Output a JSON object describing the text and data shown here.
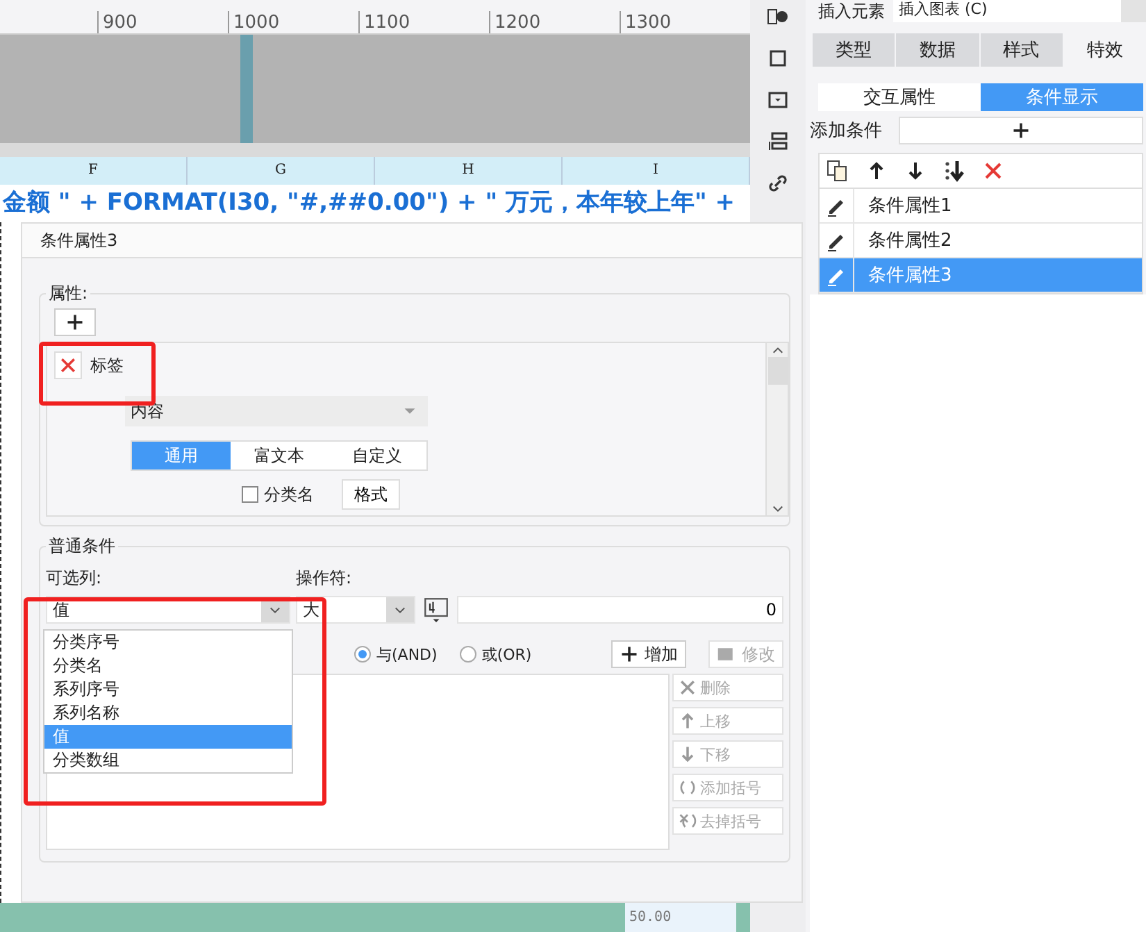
{
  "ruler": {
    "ticks": [
      "900",
      "1000",
      "1100",
      "1200",
      "1300"
    ]
  },
  "sheet": {
    "columns": [
      "F",
      "G",
      "H",
      "I"
    ],
    "formula": "金额 \" + FORMAT(I30, \"#,##0.00\") + \" 万元，本年较上年\" +",
    "footer_value": "50.00"
  },
  "right_panel": {
    "insert_label": "插入元素",
    "insert_value": "插入图表 (C)",
    "tabs": [
      {
        "label": "类型",
        "selected": false
      },
      {
        "label": "数据",
        "selected": false
      },
      {
        "label": "样式",
        "selected": false
      },
      {
        "label": "特效",
        "selected": true
      }
    ],
    "subtabs": [
      {
        "label": "交互属性",
        "selected": false
      },
      {
        "label": "条件显示",
        "selected": true
      }
    ],
    "add_condition_label": "添加条件",
    "conditions": [
      {
        "label": "条件属性1",
        "selected": false
      },
      {
        "label": "条件属性2",
        "selected": false
      },
      {
        "label": "条件属性3",
        "selected": true
      }
    ]
  },
  "dialog": {
    "title": "条件属性3",
    "properties": {
      "legend": "属性:",
      "items": [
        {
          "label": "标签"
        }
      ],
      "content_select": "内容",
      "modes": [
        {
          "label": "通用",
          "selected": true
        },
        {
          "label": "富文本",
          "selected": false
        },
        {
          "label": "自定义",
          "selected": false
        }
      ],
      "category_name": {
        "label": "分类名",
        "checked": false
      },
      "format_button": "格式"
    },
    "conditions": {
      "legend": "普通条件",
      "column_label": "可选列:",
      "operator_label": "操作符:",
      "column_value": "值",
      "operator_value": "大",
      "value": "0",
      "options": [
        {
          "label": "分类序号",
          "selected": false
        },
        {
          "label": "分类名",
          "selected": false
        },
        {
          "label": "系列序号",
          "selected": false
        },
        {
          "label": "系列名称",
          "selected": false
        },
        {
          "label": "值",
          "selected": true
        },
        {
          "label": "分类数组",
          "selected": false
        }
      ],
      "logic": [
        {
          "label": "与(AND)",
          "selected": true
        },
        {
          "label": "或(OR)",
          "selected": false
        }
      ],
      "add_button": "增加",
      "edit_button": {
        "label": "修改",
        "disabled": true
      },
      "side_buttons": [
        {
          "kind": "delete",
          "label": "删除",
          "disabled": true
        },
        {
          "kind": "up",
          "label": "上移",
          "disabled": true
        },
        {
          "kind": "down",
          "label": "下移",
          "disabled": true
        },
        {
          "kind": "add-bracket",
          "label": "添加括号",
          "disabled": true
        },
        {
          "kind": "remove-bracket",
          "label": "去掉括号",
          "disabled": true
        }
      ]
    }
  }
}
